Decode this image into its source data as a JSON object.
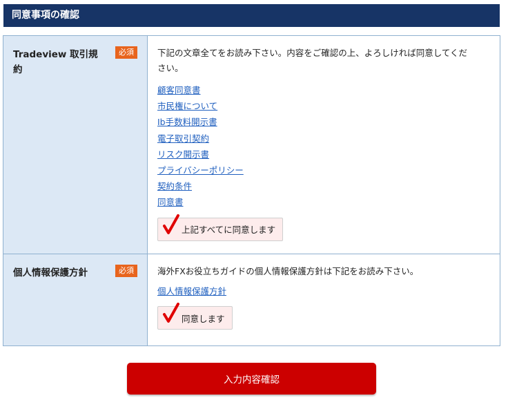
{
  "header": {
    "title": "同意事項の確認"
  },
  "sections": {
    "terms": {
      "title": "Tradeview 取引規約",
      "required_badge": "必須",
      "intro": "下記の文章全てをお読み下さい。内容をご確認の上、よろしければ同意してください。",
      "links": [
        "顧客同意書",
        "市民権について",
        "Ib手数料開示書",
        "電子取引契約",
        "リスク開示書",
        "プライバシーポリシー",
        "契約条件",
        "同意書"
      ],
      "agree_label": "上記すべてに同意します",
      "agree_checked": true
    },
    "privacy": {
      "title": "個人情報保護方針",
      "required_badge": "必須",
      "intro": "海外FXお役立ちガイドの個人情報保護方針は下記をお読み下さい。",
      "link": "個人情報保護方針",
      "agree_label": "同意します",
      "agree_checked": true
    }
  },
  "submit": {
    "label": "入力内容確認"
  },
  "colors": {
    "header_bg": "#173466",
    "badge": "#e8641d",
    "submit": "#cc0000",
    "check": "#e00000",
    "link": "#1f5fbf"
  }
}
